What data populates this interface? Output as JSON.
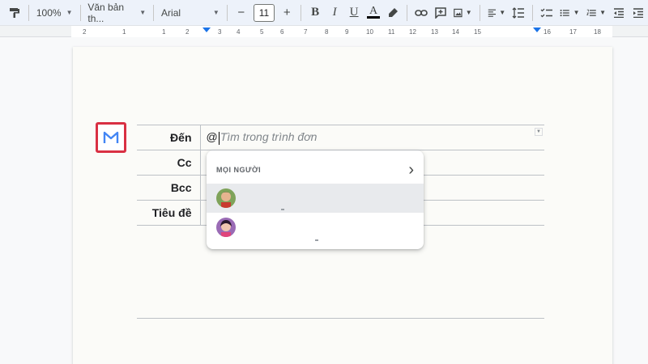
{
  "toolbar": {
    "zoom": "100%",
    "style": "Văn bản th...",
    "font": "Arial",
    "font_size": "11",
    "minus": "−",
    "plus": "+",
    "bold": "B",
    "italic": "I",
    "underline": "U",
    "font_color": "A"
  },
  "ruler": {
    "ticks": [
      "2",
      "1",
      "1",
      "2",
      "3",
      "4",
      "5",
      "6",
      "7",
      "8",
      "9",
      "10",
      "11",
      "12",
      "13",
      "14",
      "15",
      "16",
      "17",
      "18"
    ]
  },
  "email": {
    "rows": [
      {
        "label": "Đến",
        "value": "@"
      },
      {
        "label": "Cc",
        "value": ""
      },
      {
        "label": "Bcc",
        "value": ""
      },
      {
        "label": "Tiêu đề",
        "value": ""
      }
    ],
    "to_placeholder": "Tìm trong trình đơn"
  },
  "menu": {
    "heading": "MỌI NGƯỜI",
    "chevron": "›"
  },
  "colors": {
    "accent": "#1a73e8",
    "chip_border": "#d93043",
    "gmail_blue": "#4285f4"
  }
}
